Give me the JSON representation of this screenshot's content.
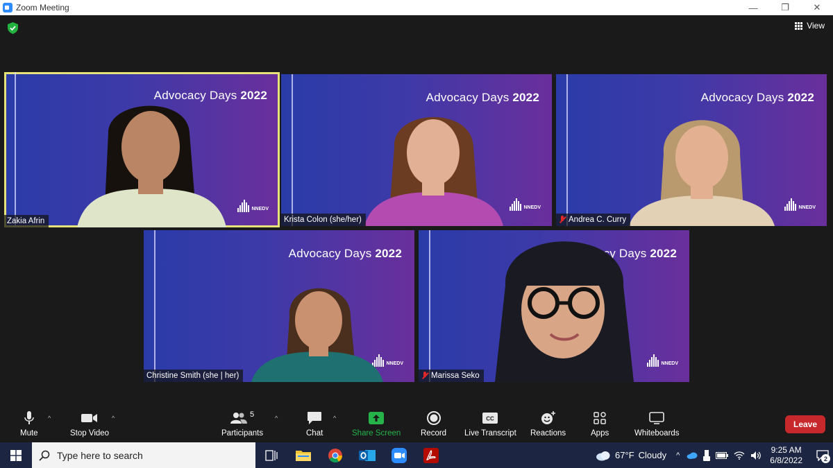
{
  "window": {
    "title": "Zoom Meeting",
    "controls": [
      "—",
      "❐",
      "✕"
    ]
  },
  "toolbar_top": {
    "view_label": "View"
  },
  "tiles": [
    {
      "name": "Zakia Afrin",
      "banner_text": "Advocacy Days",
      "banner_year": "2022",
      "logo": "NNEDV",
      "muted": false,
      "active": true
    },
    {
      "name": "Krista Colon (she/her)",
      "banner_text": "Advocacy Days",
      "banner_year": "2022",
      "logo": "NNEDV",
      "muted": false,
      "active": false
    },
    {
      "name": "Andrea C. Curry",
      "banner_text": "Advocacy Days",
      "banner_year": "2022",
      "logo": "NNEDV",
      "muted": true,
      "active": false
    },
    {
      "name": "Christine Smith (she | her)",
      "banner_text": "Advocacy Days",
      "banner_year": "2022",
      "logo": "NNEDV",
      "muted": false,
      "active": false
    },
    {
      "name": "Marissa Seko",
      "banner_text": "acy Days",
      "banner_year": "2022",
      "logo": "NNEDV",
      "muted": true,
      "active": false
    }
  ],
  "controls": {
    "mute": "Mute",
    "stop_video": "Stop Video",
    "participants": "Participants",
    "participants_count": "5",
    "chat": "Chat",
    "share_screen": "Share Screen",
    "record": "Record",
    "live_transcript": "Live Transcript",
    "reactions": "Reactions",
    "apps": "Apps",
    "whiteboards": "Whiteboards",
    "leave": "Leave"
  },
  "taskbar": {
    "search_placeholder": "Type here to search",
    "weather_temp": "67°F",
    "weather_desc": "Cloudy",
    "time": "9:25 AM",
    "date": "6/8/2022",
    "notification_count": "2"
  },
  "colors": {
    "active_outline": "#e6e378",
    "share_green": "#25b34a",
    "leave_red": "#c6282c",
    "taskbar": "#1c2541"
  }
}
